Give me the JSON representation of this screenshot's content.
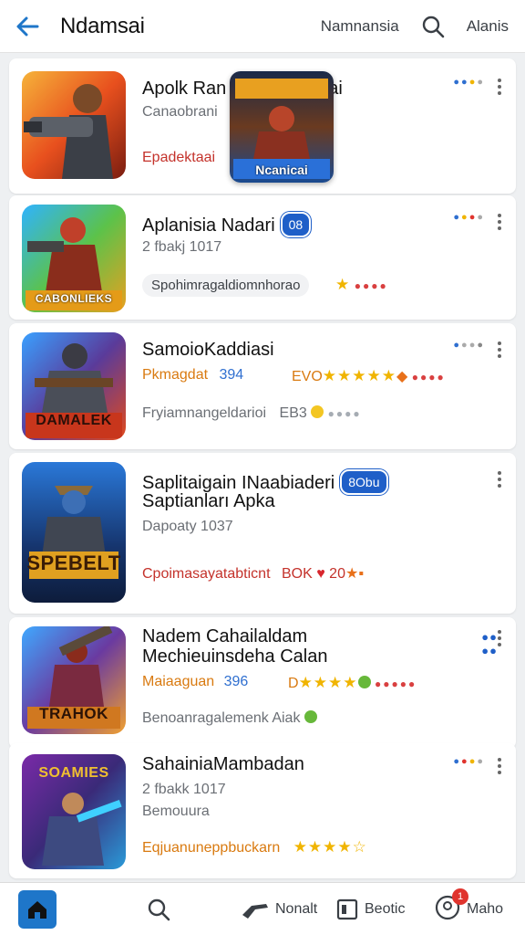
{
  "header": {
    "title": "Ndamsai",
    "link_1": "Namnansia",
    "link_2": "Alanis"
  },
  "apps": [
    {
      "name": "Apolk Ran",
      "name_tail": "ai",
      "sub": "Canaobrani",
      "red_line": "Epadektaai"
    },
    {
      "name": "Aplanisia Nadari",
      "badge": "08",
      "sub": "2 fbakj 1017",
      "pill": "Spohimragaldiomnhorao"
    },
    {
      "name": "SamoioKaddiasi",
      "stat_label": "Pkmagdat",
      "stat_value": "394",
      "rating_text": "EVO",
      "line3": "Fryiamnangeldarioi",
      "line3_value": "EB3"
    },
    {
      "name": "Saplitaigain INaabiaderi",
      "badge": "8Obu",
      "name_2": "Saptianları Apka",
      "sub": "Dapoaty 1037",
      "red_line": "Cpoimasayatabticnt",
      "red_value": "BOK",
      "heart_value": "20"
    },
    {
      "name": "Nadem Cahailaldam",
      "name_2": "Mechieuinsdeha Calan",
      "stat_label": "Maiaaguan",
      "stat_value": "396",
      "rating_text": "D",
      "line3": "Benoanragalemenk Aiak"
    },
    {
      "name": "SahainiaMambadan",
      "sub": "2 fbakk 1017",
      "sub_2": "Bemouura",
      "stat_label": "Eqjuanuneppbuckarn"
    }
  ],
  "overlay": {
    "caption": "Ncanicai"
  },
  "thumb_labels": [
    "",
    "CABONLIEKS",
    "DAMALEK",
    "SPEBELT",
    "TRAHOK",
    "SOAMIES"
  ],
  "bottom_nav": {
    "item_3": "Nonalt",
    "item_4": "Beotic",
    "item_5": "Maho",
    "notif_count": "1"
  },
  "colors": {
    "accent": "#1e76c9",
    "badge": "#1f5fc8",
    "star": "#f0b400",
    "red_text": "#c4322b"
  }
}
